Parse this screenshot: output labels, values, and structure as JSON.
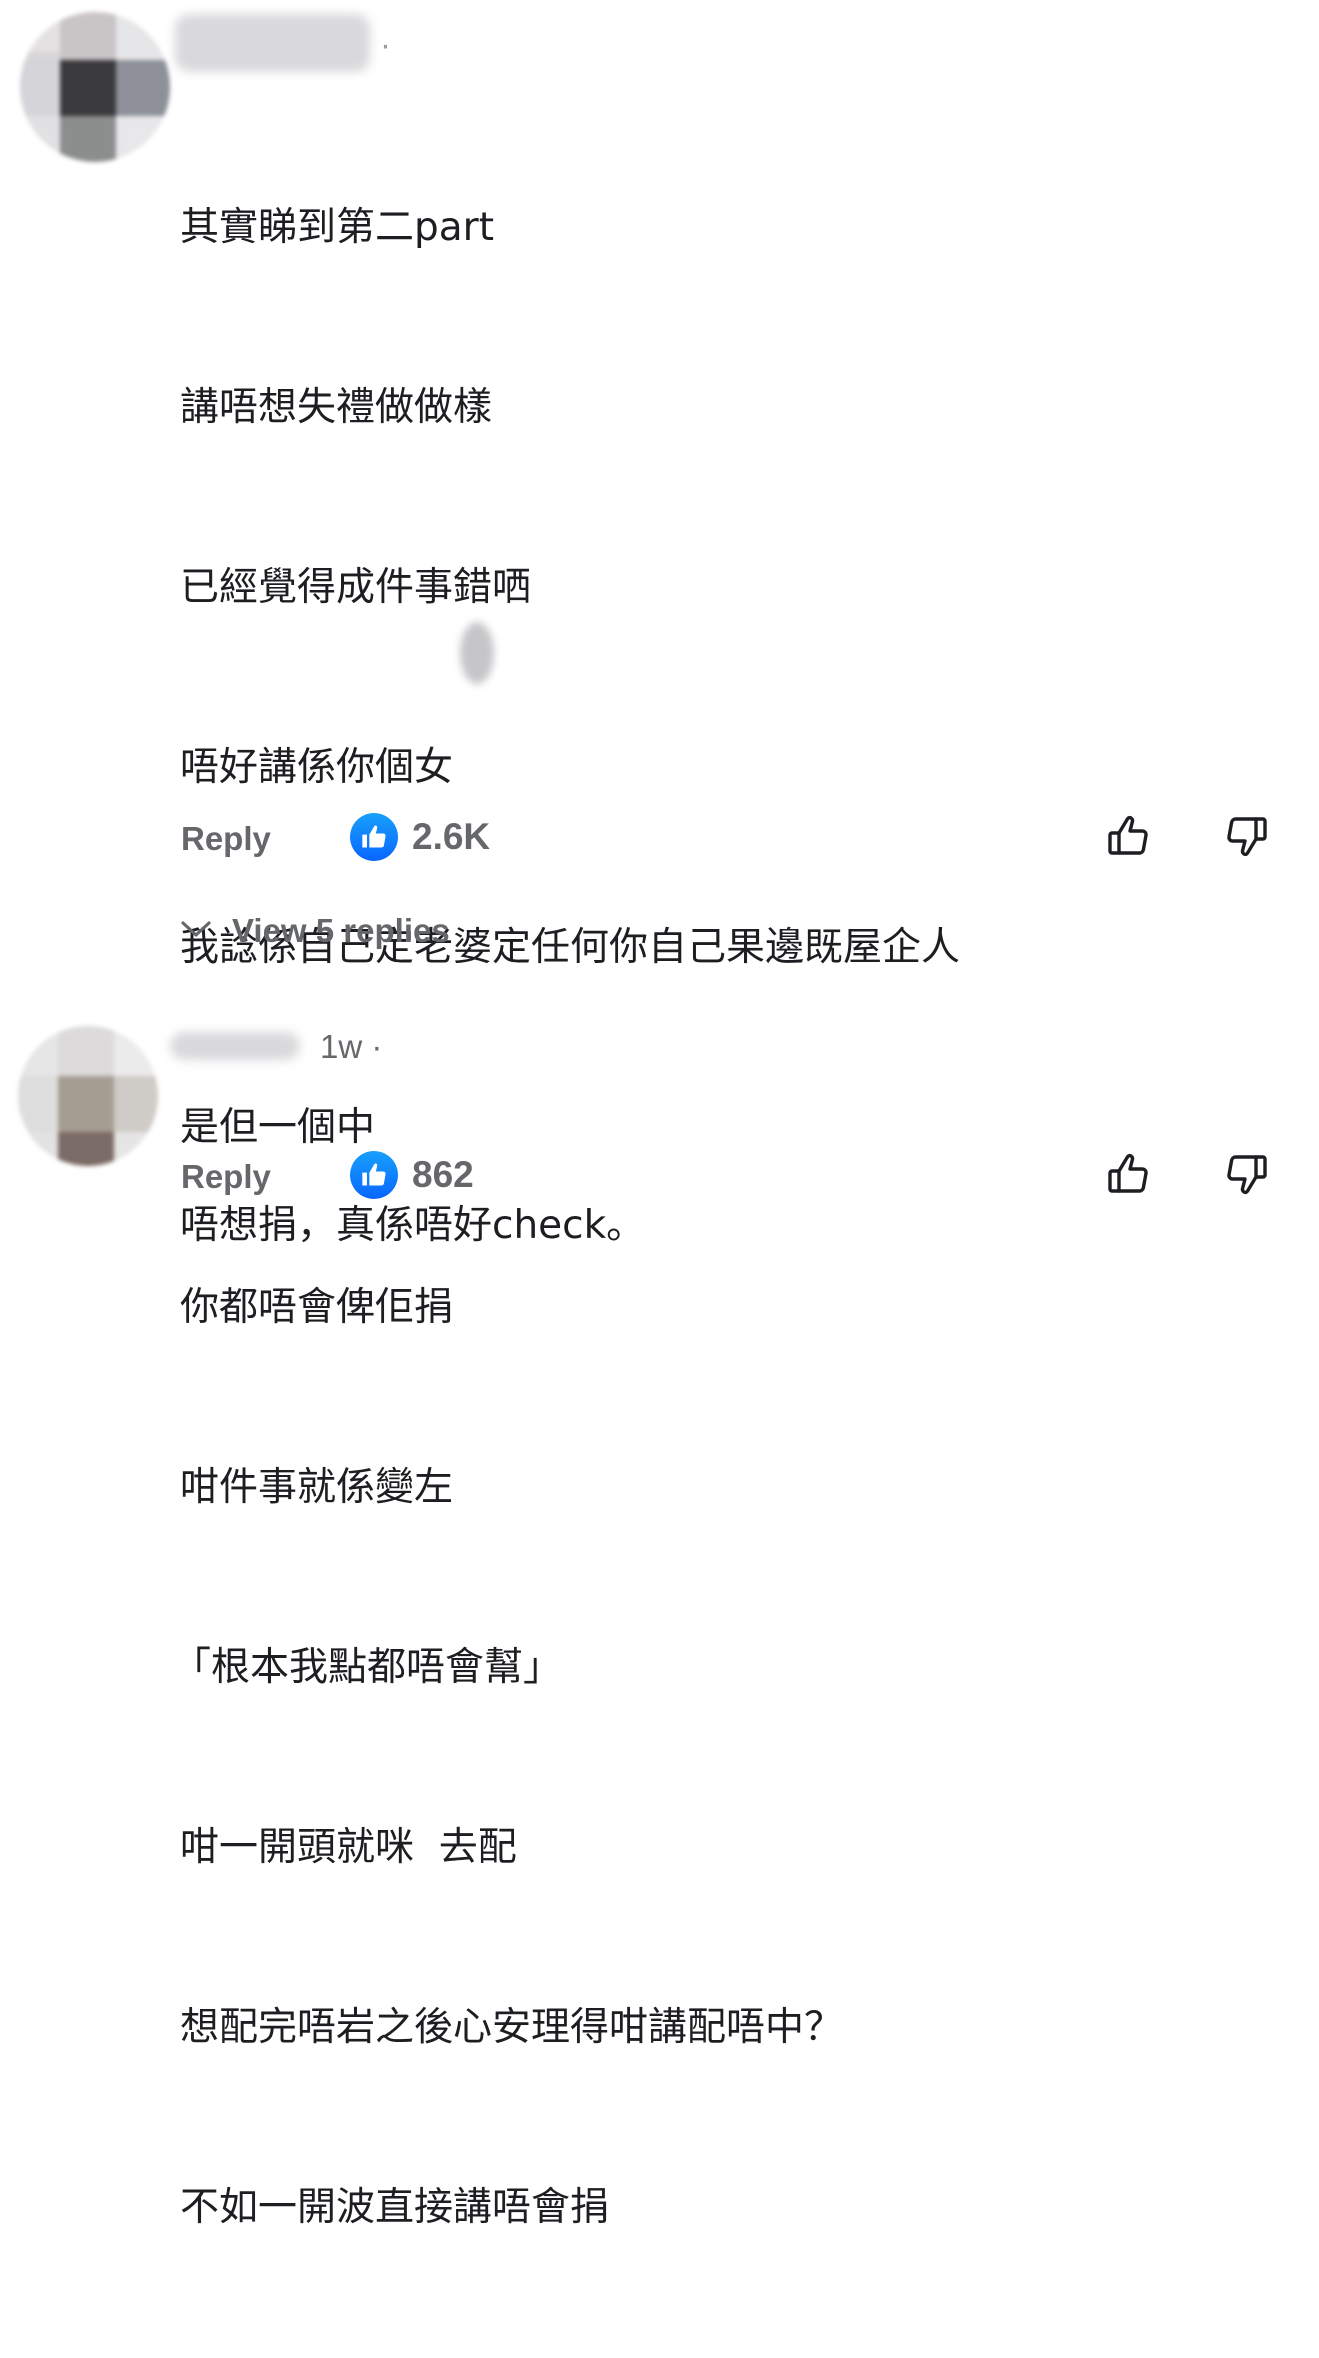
{
  "comments": [
    {
      "time": "",
      "lines": [
        "其實睇到第二part",
        "講唔想失禮做做樣",
        "已經覺得成件事錯哂",
        "唔好講係你個女",
        "我諗係自己定老婆定任何你自己果邊既屋企人",
        "是但一個中",
        "你都唔會俾佢捐",
        "咁件事就係變左",
        "「根本我點都唔會幫」",
        "咁一開頭就咪  去配",
        "想配完唔岩之後心安理得咁講配唔中？",
        "不如一開波直接講唔會捐"
      ],
      "reply_label": "Reply",
      "like_count": "2.6K",
      "view_replies": "View 5 replies"
    },
    {
      "time": "1w ·",
      "lines": [
        "唔想捐，真係唔好check。"
      ],
      "reply_label": "Reply",
      "like_count": "862"
    }
  ],
  "icons": {
    "like_badge": "like-thumb-icon",
    "like_button": "thumbs-up-outline-icon",
    "dislike_button": "thumbs-down-outline-icon",
    "expand": "chevron-down-icon"
  },
  "colors": {
    "like_blue": "#0866ff",
    "muted": "#65676b",
    "text": "#1c1e21"
  }
}
